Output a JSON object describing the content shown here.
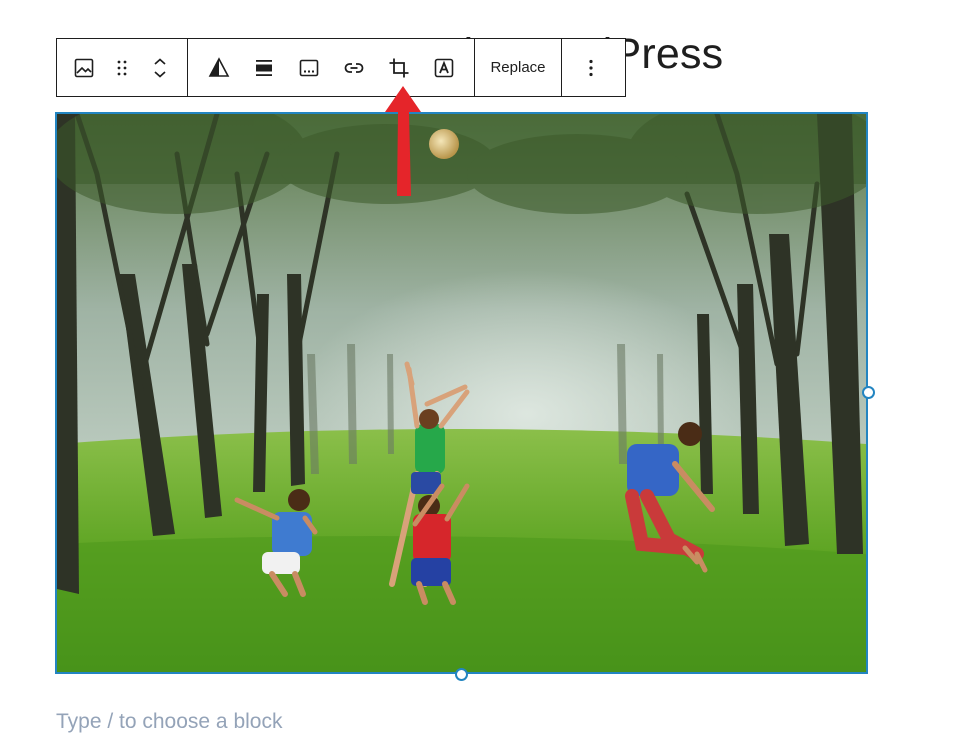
{
  "post": {
    "title": "How to Crop Images in WordPress"
  },
  "toolbar": {
    "replace_label": "Replace",
    "buttons": [
      "image-block-icon",
      "drag-handle-icon",
      "move-up-down-icon",
      "duotone-filter-icon",
      "align-icon",
      "caption-icon",
      "link-icon",
      "crop-icon",
      "text-overlay-icon",
      "more-options-icon"
    ]
  },
  "editor": {
    "placeholder": "Type / to choose a block"
  },
  "colors": {
    "selection": "#2385c1",
    "arrow": "#e5252a",
    "placeholder": "#94a3b8"
  }
}
